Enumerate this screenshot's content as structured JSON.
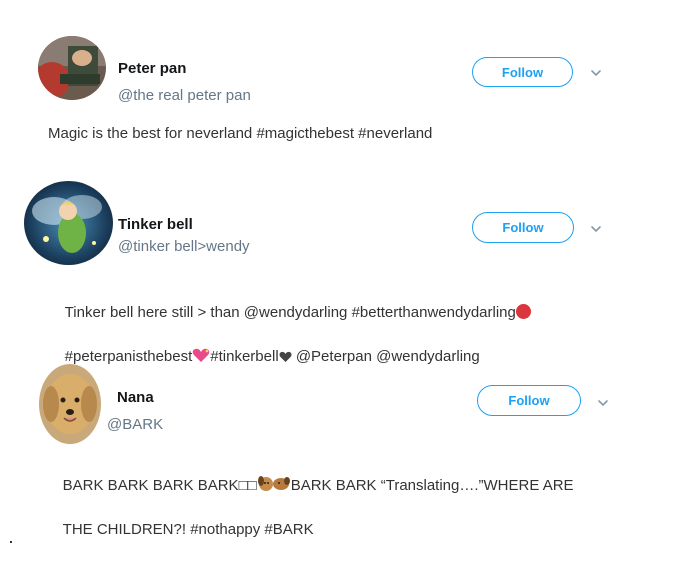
{
  "tweets": [
    {
      "name": "Peter pan",
      "handle": "@the real peter pan",
      "follow_label": "Follow",
      "text": "Magic is the best for neverland #magicthebest #neverland",
      "avatar_icon": "peter-pan-avatar"
    },
    {
      "name": "Tinker bell",
      "handle": "@tinker bell>wendy",
      "follow_label": "Follow",
      "text_line1": "Tinker bell here still > than @wendydarling #betterthanwendydarling",
      "text_line2a": "#peterpanisthebest",
      "text_line2b": "#tinkerbell",
      "text_line2c": " @Peterpan @wendydarling",
      "avatar_icon": "tinker-bell-avatar"
    },
    {
      "name": "Nana",
      "handle": "@BARK",
      "follow_label": "Follow",
      "text_line1a": "BARK BARK BARK BARK□□",
      "text_line1b": "BARK BARK “Translating….”WHERE ARE",
      "text_line2": "THE CHILDREN?! #nothappy #BARK",
      "avatar_icon": "golden-retriever-avatar"
    }
  ],
  "colors": {
    "accent": "#1da1f2",
    "name_text": "#14171a",
    "handle_text": "#657786",
    "body_text": "#333333"
  }
}
